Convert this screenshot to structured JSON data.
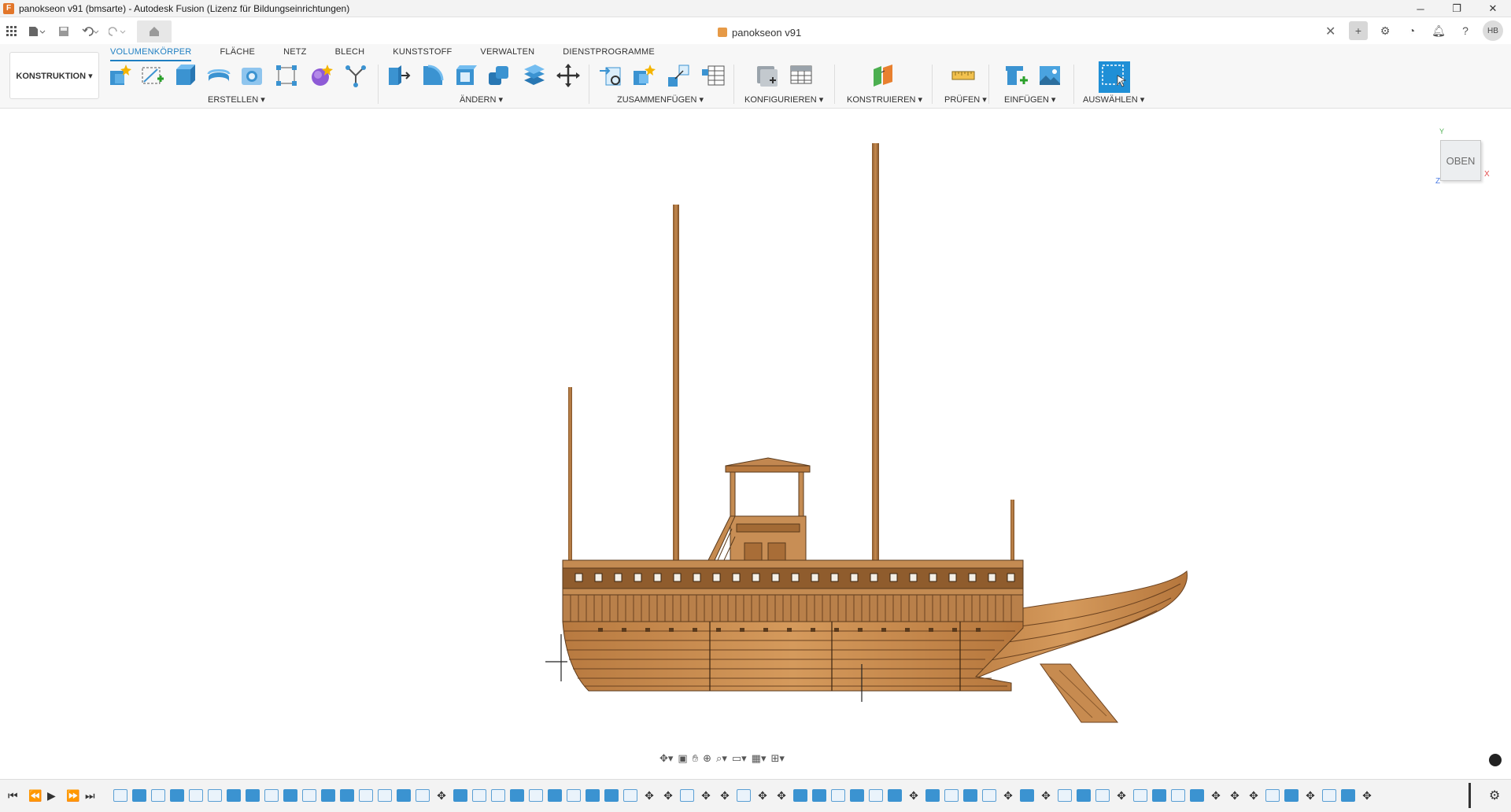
{
  "window": {
    "title": "panokseon v91 (bmsarte) - Autodesk Fusion (Lizenz für Bildungseinrichtungen)",
    "minimize": "─",
    "maximize": "❐",
    "close": "✕"
  },
  "document": {
    "tab_title": "panokseon v91",
    "close_icon": "✕"
  },
  "user": {
    "initials": "HB"
  },
  "ribbon": {
    "workspace": "KONSTRUKTION ▾",
    "tabs": [
      "VOLUMENKÖRPER",
      "FLÄCHE",
      "NETZ",
      "BLECH",
      "KUNSTSTOFF",
      "VERWALTEN",
      "DIENSTPROGRAMME"
    ],
    "active_tab": "VOLUMENKÖRPER",
    "groups": [
      "ERSTELLEN ▾",
      "ÄNDERN ▾",
      "ZUSAMMENFÜGEN ▾",
      "KONFIGURIEREN ▾",
      "KONSTRUIEREN ▾",
      "PRÜFEN ▾",
      "EINFÜGEN ▾",
      "AUSWÄHLEN ▾"
    ]
  },
  "viewcube": {
    "face": "OBEN",
    "axes": {
      "x": "X",
      "y": "Y",
      "z": "Z"
    }
  },
  "colors": {
    "accent": "#1f7fc2",
    "wood_light": "#c98a4d",
    "wood_dark": "#8a5a2e"
  }
}
